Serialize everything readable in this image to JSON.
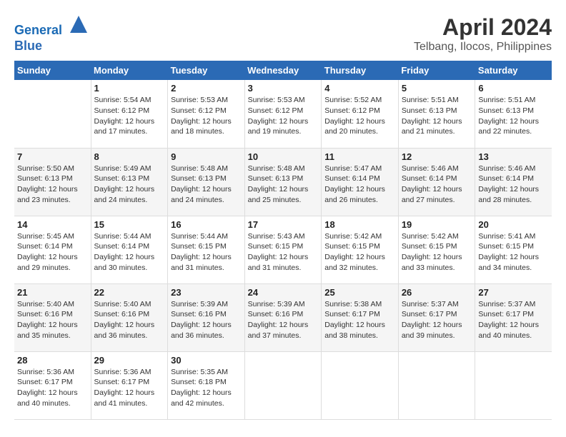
{
  "header": {
    "logo_line1": "General",
    "logo_line2": "Blue",
    "title": "April 2024",
    "subtitle": "Telbang, Ilocos, Philippines"
  },
  "days_of_week": [
    "Sunday",
    "Monday",
    "Tuesday",
    "Wednesday",
    "Thursday",
    "Friday",
    "Saturday"
  ],
  "weeks": [
    [
      {
        "day": "",
        "info": ""
      },
      {
        "day": "1",
        "info": "Sunrise: 5:54 AM\nSunset: 6:12 PM\nDaylight: 12 hours\nand 17 minutes."
      },
      {
        "day": "2",
        "info": "Sunrise: 5:53 AM\nSunset: 6:12 PM\nDaylight: 12 hours\nand 18 minutes."
      },
      {
        "day": "3",
        "info": "Sunrise: 5:53 AM\nSunset: 6:12 PM\nDaylight: 12 hours\nand 19 minutes."
      },
      {
        "day": "4",
        "info": "Sunrise: 5:52 AM\nSunset: 6:12 PM\nDaylight: 12 hours\nand 20 minutes."
      },
      {
        "day": "5",
        "info": "Sunrise: 5:51 AM\nSunset: 6:13 PM\nDaylight: 12 hours\nand 21 minutes."
      },
      {
        "day": "6",
        "info": "Sunrise: 5:51 AM\nSunset: 6:13 PM\nDaylight: 12 hours\nand 22 minutes."
      }
    ],
    [
      {
        "day": "7",
        "info": "Sunrise: 5:50 AM\nSunset: 6:13 PM\nDaylight: 12 hours\nand 23 minutes."
      },
      {
        "day": "8",
        "info": "Sunrise: 5:49 AM\nSunset: 6:13 PM\nDaylight: 12 hours\nand 24 minutes."
      },
      {
        "day": "9",
        "info": "Sunrise: 5:48 AM\nSunset: 6:13 PM\nDaylight: 12 hours\nand 24 minutes."
      },
      {
        "day": "10",
        "info": "Sunrise: 5:48 AM\nSunset: 6:13 PM\nDaylight: 12 hours\nand 25 minutes."
      },
      {
        "day": "11",
        "info": "Sunrise: 5:47 AM\nSunset: 6:14 PM\nDaylight: 12 hours\nand 26 minutes."
      },
      {
        "day": "12",
        "info": "Sunrise: 5:46 AM\nSunset: 6:14 PM\nDaylight: 12 hours\nand 27 minutes."
      },
      {
        "day": "13",
        "info": "Sunrise: 5:46 AM\nSunset: 6:14 PM\nDaylight: 12 hours\nand 28 minutes."
      }
    ],
    [
      {
        "day": "14",
        "info": "Sunrise: 5:45 AM\nSunset: 6:14 PM\nDaylight: 12 hours\nand 29 minutes."
      },
      {
        "day": "15",
        "info": "Sunrise: 5:44 AM\nSunset: 6:14 PM\nDaylight: 12 hours\nand 30 minutes."
      },
      {
        "day": "16",
        "info": "Sunrise: 5:44 AM\nSunset: 6:15 PM\nDaylight: 12 hours\nand 31 minutes."
      },
      {
        "day": "17",
        "info": "Sunrise: 5:43 AM\nSunset: 6:15 PM\nDaylight: 12 hours\nand 31 minutes."
      },
      {
        "day": "18",
        "info": "Sunrise: 5:42 AM\nSunset: 6:15 PM\nDaylight: 12 hours\nand 32 minutes."
      },
      {
        "day": "19",
        "info": "Sunrise: 5:42 AM\nSunset: 6:15 PM\nDaylight: 12 hours\nand 33 minutes."
      },
      {
        "day": "20",
        "info": "Sunrise: 5:41 AM\nSunset: 6:15 PM\nDaylight: 12 hours\nand 34 minutes."
      }
    ],
    [
      {
        "day": "21",
        "info": "Sunrise: 5:40 AM\nSunset: 6:16 PM\nDaylight: 12 hours\nand 35 minutes."
      },
      {
        "day": "22",
        "info": "Sunrise: 5:40 AM\nSunset: 6:16 PM\nDaylight: 12 hours\nand 36 minutes."
      },
      {
        "day": "23",
        "info": "Sunrise: 5:39 AM\nSunset: 6:16 PM\nDaylight: 12 hours\nand 36 minutes."
      },
      {
        "day": "24",
        "info": "Sunrise: 5:39 AM\nSunset: 6:16 PM\nDaylight: 12 hours\nand 37 minutes."
      },
      {
        "day": "25",
        "info": "Sunrise: 5:38 AM\nSunset: 6:17 PM\nDaylight: 12 hours\nand 38 minutes."
      },
      {
        "day": "26",
        "info": "Sunrise: 5:37 AM\nSunset: 6:17 PM\nDaylight: 12 hours\nand 39 minutes."
      },
      {
        "day": "27",
        "info": "Sunrise: 5:37 AM\nSunset: 6:17 PM\nDaylight: 12 hours\nand 40 minutes."
      }
    ],
    [
      {
        "day": "28",
        "info": "Sunrise: 5:36 AM\nSunset: 6:17 PM\nDaylight: 12 hours\nand 40 minutes."
      },
      {
        "day": "29",
        "info": "Sunrise: 5:36 AM\nSunset: 6:17 PM\nDaylight: 12 hours\nand 41 minutes."
      },
      {
        "day": "30",
        "info": "Sunrise: 5:35 AM\nSunset: 6:18 PM\nDaylight: 12 hours\nand 42 minutes."
      },
      {
        "day": "",
        "info": ""
      },
      {
        "day": "",
        "info": ""
      },
      {
        "day": "",
        "info": ""
      },
      {
        "day": "",
        "info": ""
      }
    ]
  ]
}
